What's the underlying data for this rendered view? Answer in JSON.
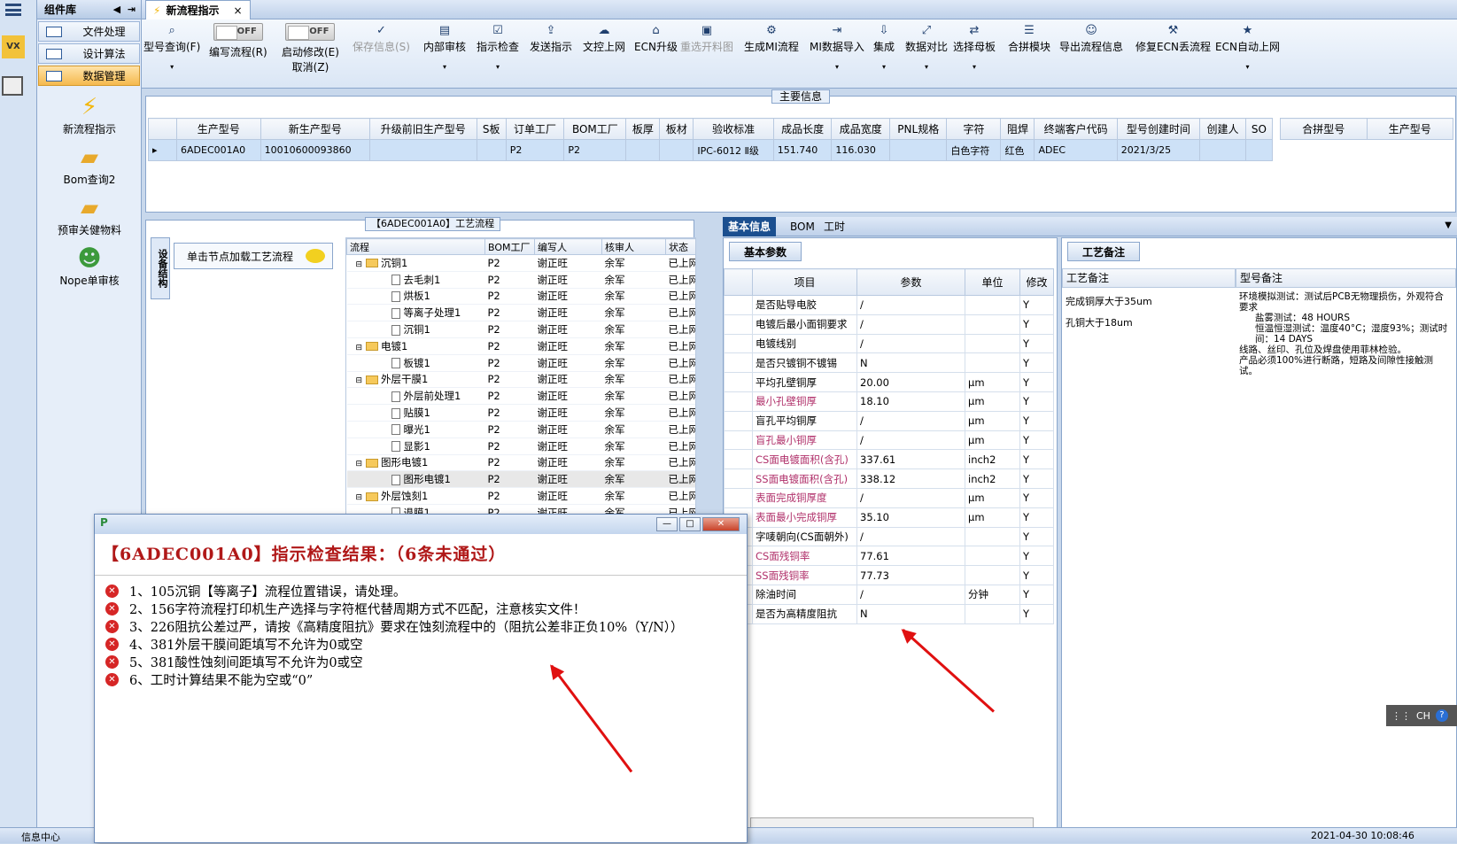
{
  "left_panel": {
    "title": "组件库",
    "nav": [
      {
        "label": "文件处理"
      },
      {
        "label": "设计算法"
      },
      {
        "label": "数据管理"
      }
    ],
    "tools": [
      {
        "label": "新流程指示",
        "icon": "lightning-icon"
      },
      {
        "label": "Bom查询2",
        "icon": "folder-icon"
      },
      {
        "label": "预审关健物料",
        "icon": "folder-icon"
      },
      {
        "label": "Nope单审核",
        "icon": "user-icon"
      }
    ]
  },
  "tab": {
    "label": "新流程指示",
    "close": "×"
  },
  "ribbon": {
    "model_query": "型号查询(F)",
    "edit_flow": "编写流程(R)",
    "toggle_off": "OFF",
    "auto_modify": "启动修改(E)",
    "cancel": "取消(Z)",
    "buttons": [
      "保存信息(S)",
      "内部审核",
      "指示检查",
      "发送指示",
      "文控上网",
      "ECN升级",
      "重选开料图",
      "生成MI流程",
      "MI数据导入",
      "集成",
      "数据对比",
      "选择母板",
      "合拼模块",
      "导出流程信息",
      "修复ECN丢流程",
      "ECN自动上网"
    ]
  },
  "main_info": {
    "title": "主要信息",
    "headers": [
      "生产型号",
      "新生产型号",
      "升级前旧生产型号",
      "S板",
      "订单工厂",
      "BOM工厂",
      "板厚",
      "板材",
      "验收标准",
      "成品长度",
      "成品宽度",
      "PNL规格",
      "字符",
      "阻焊",
      "终端客户代码",
      "型号创建时间",
      "创建人",
      "SO"
    ],
    "row": [
      "6ADEC001A0",
      "10010600093860",
      "",
      "",
      "P2",
      "P2",
      "",
      "",
      "IPC-6012 Ⅱ级",
      "151.740",
      "116.030",
      "",
      "白色字符",
      "红色",
      "ADEC",
      "2021/3/25",
      "",
      ""
    ],
    "side_headers": [
      "合拼型号",
      "生产型号"
    ]
  },
  "process": {
    "title": "【6ADEC001A0】工艺流程",
    "vtab": "设备结构",
    "load_hint": "单击节点加载工艺流程",
    "headers": [
      "流程",
      "BOM工厂",
      "编写人",
      "核审人",
      "状态"
    ],
    "rows": [
      {
        "level": 0,
        "name": "沉铜1",
        "f": "P2",
        "w": "谢正旺",
        "c": "余军",
        "s": "已上网"
      },
      {
        "level": 1,
        "name": "去毛刺1",
        "f": "P2",
        "w": "谢正旺",
        "c": "余军",
        "s": "已上网"
      },
      {
        "level": 1,
        "name": "烘板1",
        "f": "P2",
        "w": "谢正旺",
        "c": "余军",
        "s": "已上网"
      },
      {
        "level": 1,
        "name": "等离子处理1",
        "f": "P2",
        "w": "谢正旺",
        "c": "余军",
        "s": "已上网"
      },
      {
        "level": 1,
        "name": "沉铜1",
        "f": "P2",
        "w": "谢正旺",
        "c": "余军",
        "s": "已上网"
      },
      {
        "level": 0,
        "name": "电镀1",
        "f": "P2",
        "w": "谢正旺",
        "c": "余军",
        "s": "已上网"
      },
      {
        "level": 1,
        "name": "板镀1",
        "f": "P2",
        "w": "谢正旺",
        "c": "余军",
        "s": "已上网"
      },
      {
        "level": 0,
        "name": "外层干膜1",
        "f": "P2",
        "w": "谢正旺",
        "c": "余军",
        "s": "已上网"
      },
      {
        "level": 1,
        "name": "外层前处理1",
        "f": "P2",
        "w": "谢正旺",
        "c": "余军",
        "s": "已上网"
      },
      {
        "level": 1,
        "name": "贴膜1",
        "f": "P2",
        "w": "谢正旺",
        "c": "余军",
        "s": "已上网"
      },
      {
        "level": 1,
        "name": "曝光1",
        "f": "P2",
        "w": "谢正旺",
        "c": "余军",
        "s": "已上网"
      },
      {
        "level": 1,
        "name": "显影1",
        "f": "P2",
        "w": "谢正旺",
        "c": "余军",
        "s": "已上网"
      },
      {
        "level": 0,
        "name": "图形电镀1",
        "f": "P2",
        "w": "谢正旺",
        "c": "余军",
        "s": "已上网"
      },
      {
        "level": 1,
        "name": "图形电镀1",
        "f": "P2",
        "w": "谢正旺",
        "c": "余军",
        "s": "已上网"
      },
      {
        "level": 0,
        "name": "外层蚀刻1",
        "f": "P2",
        "w": "谢正旺",
        "c": "余军",
        "s": "已上网"
      },
      {
        "level": 1,
        "name": "退膜1",
        "f": "P2",
        "w": "谢正旺",
        "c": "余军",
        "s": "已上网"
      }
    ]
  },
  "right_tabs": [
    "基本信息",
    "BOM",
    "工时"
  ],
  "basic": {
    "tab": "基本参数",
    "headers": [
      "项目",
      "参数",
      "单位",
      "修改"
    ],
    "rows": [
      {
        "k": "是否贴导电胶",
        "v": "/",
        "u": "",
        "m": "Y",
        "hl": false
      },
      {
        "k": "电镀后最小面铜要求",
        "v": "/",
        "u": "",
        "m": "Y",
        "hl": false
      },
      {
        "k": "电镀线别",
        "v": "/",
        "u": "",
        "m": "Y",
        "hl": false
      },
      {
        "k": "是否只镀铜不镀锡",
        "v": "N",
        "u": "",
        "m": "Y",
        "hl": false
      },
      {
        "k": "平均孔壁铜厚",
        "v": "20.00",
        "u": "μm",
        "m": "Y",
        "hl": false
      },
      {
        "k": "最小孔壁铜厚",
        "v": "18.10",
        "u": "μm",
        "m": "Y",
        "hl": true
      },
      {
        "k": "盲孔平均铜厚",
        "v": "/",
        "u": "μm",
        "m": "Y",
        "hl": false
      },
      {
        "k": "盲孔最小铜厚",
        "v": "/",
        "u": "μm",
        "m": "Y",
        "hl": true
      },
      {
        "k": "CS面电镀面积(含孔)",
        "v": "337.61",
        "u": "inch2",
        "m": "Y",
        "hl": true
      },
      {
        "k": "SS面电镀面积(含孔)",
        "v": "338.12",
        "u": "inch2",
        "m": "Y",
        "hl": true
      },
      {
        "k": "表面完成铜厚度",
        "v": "/",
        "u": "μm",
        "m": "Y",
        "hl": true
      },
      {
        "k": "表面最小完成铜厚",
        "v": "35.10",
        "u": "μm",
        "m": "Y",
        "hl": true
      },
      {
        "k": "字唛朝向(CS面朝外)",
        "v": "/",
        "u": "",
        "m": "Y",
        "hl": false
      },
      {
        "k": "CS面残铜率",
        "v": "77.61",
        "u": "",
        "m": "Y",
        "hl": true
      },
      {
        "k": "SS面残铜率",
        "v": "77.73",
        "u": "",
        "m": "Y",
        "hl": true
      },
      {
        "k": "除油时间",
        "v": "/",
        "u": "分钟",
        "m": "Y",
        "hl": false
      },
      {
        "k": "是否为高精度阻抗",
        "v": "N",
        "u": "",
        "m": "Y",
        "hl": false
      }
    ]
  },
  "notes": {
    "tab": "工艺备注",
    "col1": "工艺备注",
    "col2": "型号备注",
    "note1": [
      "完成铜厚大于35um",
      "孔铜大于18um"
    ],
    "note2": [
      "环境模拟测试：测试后PCB无物理损伤，外观符合要求",
      "盐雾测试：48 HOURS",
      "恒温恒湿测试：温度40°C；湿度93%；测试时间：14 DAYS",
      "线路、丝印、孔位及焊盘使用菲林检验。",
      "产品必须100%进行断路，短路及间隙性接触测试。"
    ]
  },
  "dialog": {
    "title": "【6ADEC001A0】指示检查结果：（6条未通过）",
    "errors": [
      "1、105沉铜【等离子】流程位置错误，请处理。",
      "2、156字符流程打印机生产选择与字符框代替周期方式不匹配，注意核实文件！",
      "3、226阻抗公差过严，请按《高精度阻抗》要求在蚀刻流程中的（阻抗公差非正负10%（Y/N））",
      "4、381外层干膜间距填写不允许为0或空",
      "5、381酸性蚀刻间距填写不允许为0或空",
      "6、工时计算结果不能为空或“0”"
    ]
  },
  "ime": "CH",
  "status": {
    "left": "信息中心",
    "right": "2021-04-30 10:08:46"
  },
  "colors": {
    "accent": "#1b4f8f",
    "error": "#b01818",
    "highlight": "#b0306a",
    "arrow": "#e01010"
  }
}
